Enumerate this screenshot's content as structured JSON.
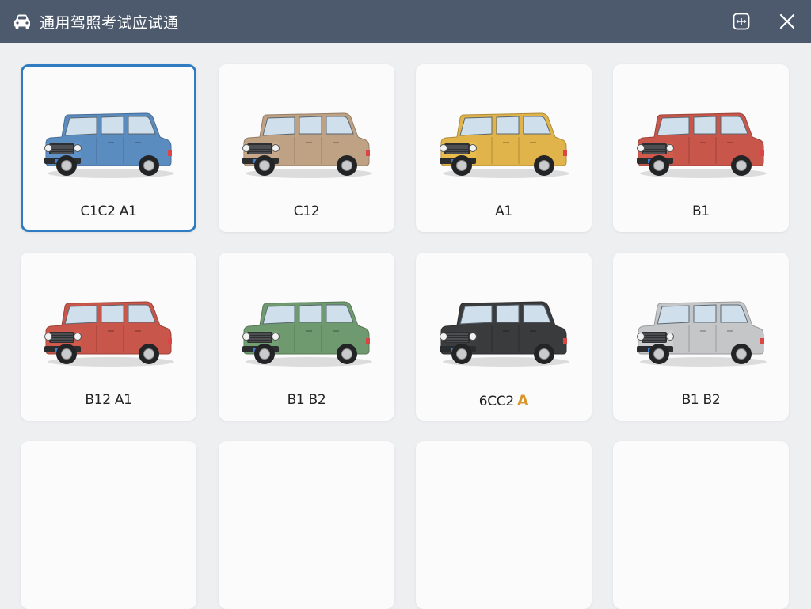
{
  "window": {
    "title": "通用驾照考试应试通"
  },
  "cards": [
    {
      "label": "C1C2 A1",
      "color": "#5b8cc0",
      "selected": true
    },
    {
      "label": "C12",
      "color": "#bfa184"
    },
    {
      "label": "A1",
      "color": "#e0b44a"
    },
    {
      "label": "B1",
      "color": "#c9564a"
    },
    {
      "label": "B12 A1",
      "color": "#c8564a"
    },
    {
      "label": "B1 B2",
      "color": "#6f9a6f"
    },
    {
      "label": "6CC2",
      "badge": "A",
      "color": "#3a3b3d"
    },
    {
      "label": "B1 B2",
      "color": "#c4c6c8"
    }
  ],
  "colors": {
    "titlebar": "#4d5a6d",
    "accent": "#2f7cc2",
    "background": "#eeeff1"
  },
  "icons": {
    "app": "car-icon",
    "tool": "expand-icon",
    "close": "close-icon"
  }
}
